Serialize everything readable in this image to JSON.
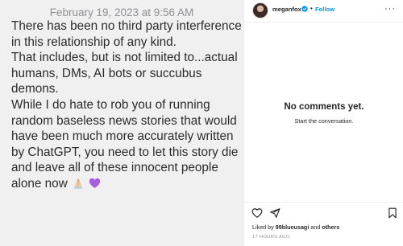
{
  "post": {
    "date": "February 19, 2023 at 9:56 AM",
    "lines": [
      "There has been no third party interference",
      "in this relationship of any kind.",
      "That includes, but is not limited to...actual",
      "humans, DMs, AI bots or succubus",
      "demons.",
      "While I do hate to rob you of running",
      "random baseless news stories that would",
      "have been much more accurately written",
      "by ChatGPT, you need to let this story die",
      "and leave all of these innocent people",
      "alone now"
    ],
    "emojis": [
      "praying-hands-icon",
      "purple-heart-icon"
    ]
  },
  "header": {
    "username": "meganfox",
    "separator": "•",
    "follow_label": "Follow",
    "more_label": "···"
  },
  "comments": {
    "empty_title": "No comments yet.",
    "empty_subtitle": "Start the conversation."
  },
  "footer": {
    "likes_prefix": "Liked by ",
    "likes_user": "99blueusagi",
    "likes_middle": " and ",
    "likes_others": "others",
    "time": "17 HOURS AGO"
  },
  "colors": {
    "accent": "#0095f6",
    "purple_heart": "#9b5de5"
  }
}
